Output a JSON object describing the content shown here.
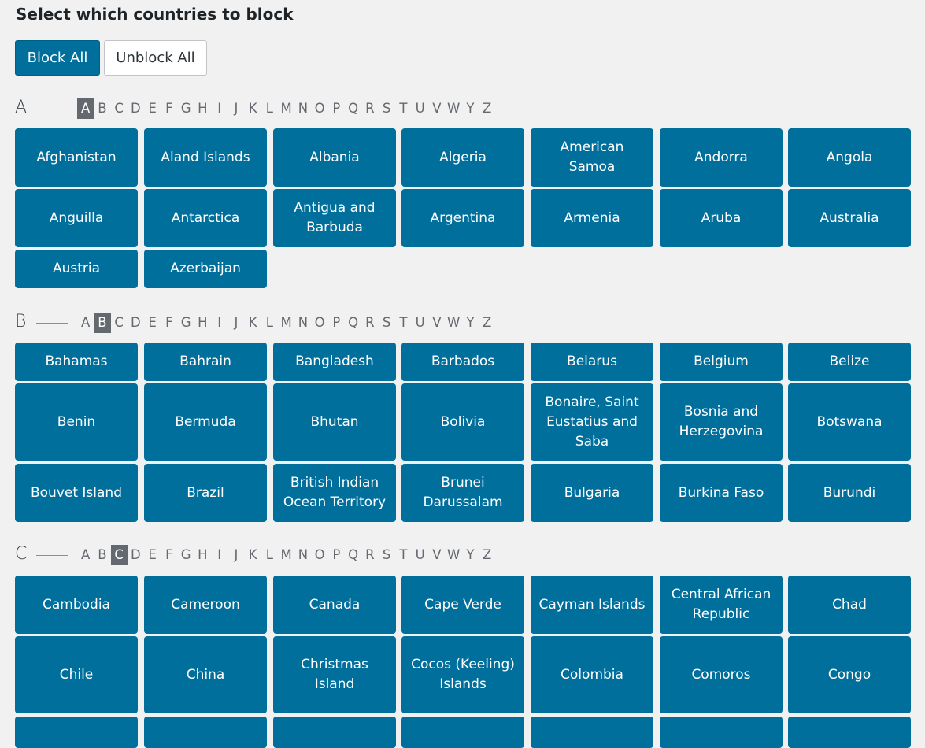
{
  "title": "Select which countries to block",
  "buttons": {
    "block_all": "Block All",
    "unblock_all": "Unblock All"
  },
  "alphabet": [
    "A",
    "B",
    "C",
    "D",
    "E",
    "F",
    "G",
    "H",
    "I",
    "J",
    "K",
    "L",
    "M",
    "N",
    "O",
    "P",
    "Q",
    "R",
    "S",
    "T",
    "U",
    "V",
    "W",
    "Y",
    "Z"
  ],
  "sections": [
    {
      "letter": "A",
      "countries": [
        "Afghanistan",
        "Aland Islands",
        "Albania",
        "Algeria",
        "American Samoa",
        "Andorra",
        "Angola",
        "Anguilla",
        "Antarctica",
        "Antigua and Barbuda",
        "Argentina",
        "Armenia",
        "Aruba",
        "Australia",
        "Austria",
        "Azerbaijan"
      ]
    },
    {
      "letter": "B",
      "countries": [
        "Bahamas",
        "Bahrain",
        "Bangladesh",
        "Barbados",
        "Belarus",
        "Belgium",
        "Belize",
        "Benin",
        "Bermuda",
        "Bhutan",
        "Bolivia",
        "Bonaire, Saint Eustatius and Saba",
        "Bosnia and Herzegovina",
        "Botswana",
        "Bouvet Island",
        "Brazil",
        "British Indian Ocean Territory",
        "Brunei Darussalam",
        "Bulgaria",
        "Burkina Faso",
        "Burundi"
      ]
    },
    {
      "letter": "C",
      "countries": [
        "Cambodia",
        "Cameroon",
        "Canada",
        "Cape Verde",
        "Cayman Islands",
        "Central African Republic",
        "Chad",
        "Chile",
        "China",
        "Christmas Island",
        "Cocos (Keeling) Islands",
        "Colombia",
        "Comoros",
        "Congo",
        "",
        "",
        "",
        "",
        "",
        "",
        ""
      ]
    }
  ]
}
